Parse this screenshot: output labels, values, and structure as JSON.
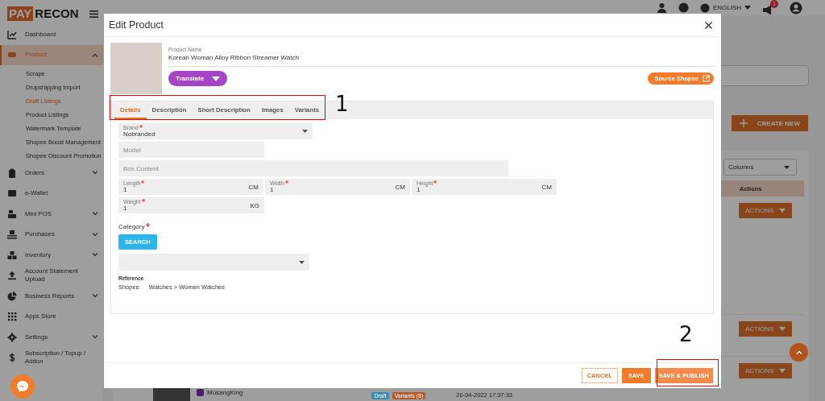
{
  "logo": {
    "left": "PAY",
    "right": "RECON"
  },
  "sidebar": {
    "items": [
      {
        "label": "Dashboard",
        "selected": false
      },
      {
        "label": "Product",
        "selected": true,
        "expanded": true,
        "children": [
          {
            "label": "Scrape",
            "selected": false
          },
          {
            "label": "Dropshipping Import",
            "selected": false
          },
          {
            "label": "Draft Listings",
            "selected": true
          },
          {
            "label": "Product Listings",
            "selected": false
          },
          {
            "label": "Watermark Template",
            "selected": false
          },
          {
            "label": "Shopee Boost Management",
            "selected": false
          },
          {
            "label": "Shopee Discount Promotion",
            "selected": false
          }
        ]
      },
      {
        "label": "Orders",
        "selected": false,
        "expanded": false
      },
      {
        "label": "e-Wallet",
        "selected": false
      },
      {
        "label": "Mini POS",
        "selected": false,
        "expanded": false
      },
      {
        "label": "Purchases",
        "selected": false,
        "expanded": false
      },
      {
        "label": "Inventory",
        "selected": false,
        "expanded": false
      },
      {
        "label": "Account Statement Upload",
        "selected": false
      },
      {
        "label": "Business Reports",
        "selected": false,
        "expanded": false
      },
      {
        "label": "Apps Store",
        "selected": false
      },
      {
        "label": "Settings",
        "selected": false,
        "expanded": false
      },
      {
        "label": "Subscription / Topup / Addon",
        "selected": false
      }
    ]
  },
  "topbar": {
    "language": "ENGLISH",
    "notification_count": "1"
  },
  "page": {
    "create_button": "CREATE NEW",
    "columns_select": "Columns",
    "table": {
      "columns": [
        "Actions"
      ],
      "rows": [
        {
          "action": "ACTIONS"
        },
        {
          "action": "ACTIONS"
        },
        {
          "action": "ACTIONS",
          "product": "MusangKing",
          "tags": [
            {
              "label": "Draft",
              "color": "#3a8cb5"
            },
            {
              "label": "Variants (8)",
              "color": "#b55a28"
            }
          ],
          "date": "20-04-2022 17:37:33"
        }
      ]
    }
  },
  "modal": {
    "title": "Edit Product",
    "product_name_label": "Product Name",
    "product_name": "Korean Woman Alloy Ribbon Streamer Watch",
    "translate_button": "Translate",
    "source_button": "Source Shopee",
    "tabs": [
      {
        "label": "Details",
        "selected": true
      },
      {
        "label": "Description",
        "selected": false
      },
      {
        "label": "Short Description",
        "selected": false
      },
      {
        "label": "Images",
        "selected": false
      },
      {
        "label": "Variants",
        "selected": false
      }
    ],
    "field_rows": [
      [
        {
          "kind": "select",
          "label": "Brand",
          "required": true,
          "value": "Nobranded"
        }
      ],
      [
        {
          "kind": "text",
          "placeholder": "Model"
        }
      ],
      [
        {
          "kind": "text",
          "placeholder": "Box Content"
        }
      ],
      [
        {
          "kind": "measure",
          "label": "Length",
          "required": true,
          "value": "1",
          "unit": "CM"
        },
        {
          "kind": "measure",
          "label": "Width",
          "required": true,
          "value": "1",
          "unit": "CM"
        },
        {
          "kind": "measure",
          "label": "Height",
          "required": true,
          "value": "1",
          "unit": "CM"
        }
      ],
      [
        {
          "kind": "measure",
          "label": "Weight",
          "required": true,
          "value": "1",
          "unit": "KG"
        }
      ]
    ],
    "category": {
      "label": "Category",
      "required": true,
      "search_button": "SEARCH"
    },
    "reference": {
      "label": "Reference",
      "source": "Shopee",
      "path": "Watches > Women Watches"
    },
    "buttons": [
      {
        "label": "CANCEL",
        "kind": "outline"
      },
      {
        "label": "SAVE",
        "kind": "primary"
      },
      {
        "label": "SAVE & PUBLISH",
        "kind": "light"
      }
    ]
  },
  "annotations": [
    {
      "label": "1"
    },
    {
      "label": "2"
    }
  ]
}
